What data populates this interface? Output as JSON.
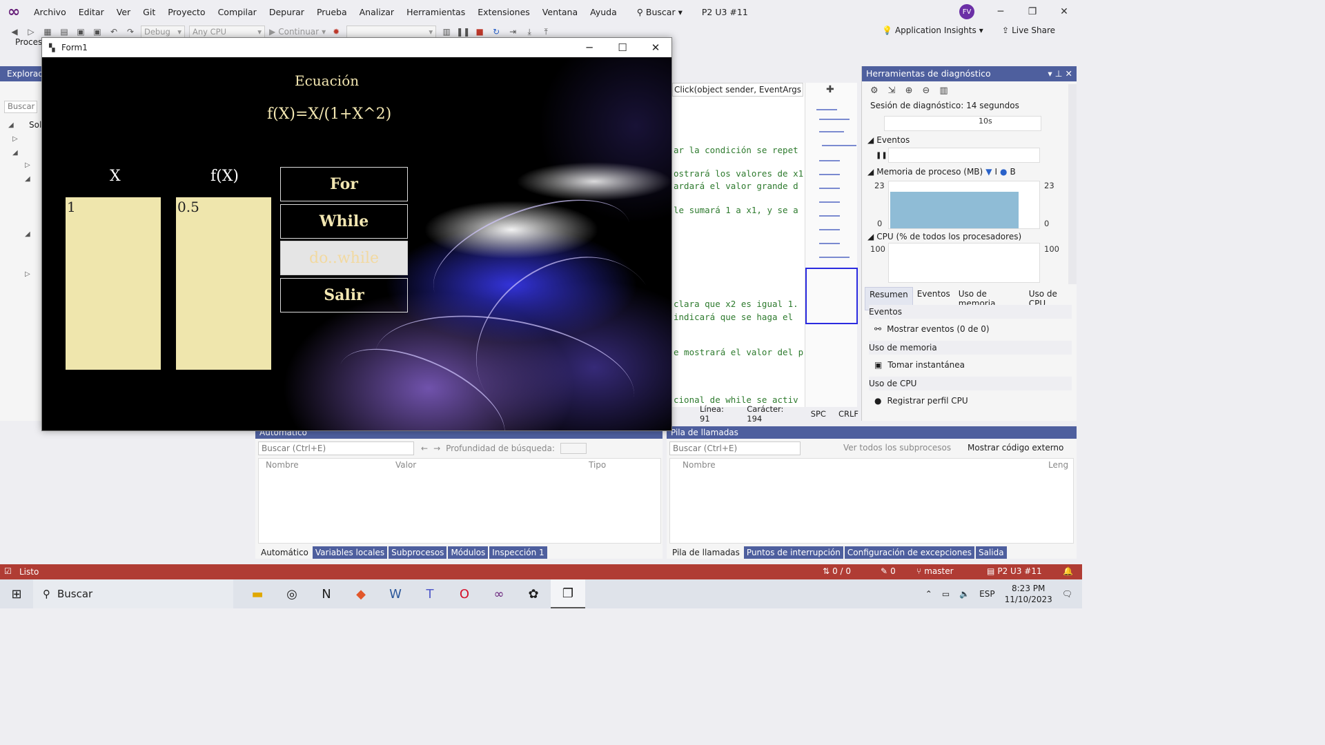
{
  "menu": {
    "items": [
      "Archivo",
      "Editar",
      "Ver",
      "Git",
      "Proyecto",
      "Compilar",
      "Depurar",
      "Prueba",
      "Analizar",
      "Herramientas",
      "Extensiones",
      "Ventana",
      "Ayuda"
    ],
    "search_label": "Buscar",
    "solution_name": "P2 U3 #11",
    "avatar_initials": "FV"
  },
  "toolbar": {
    "config": "Debug",
    "platform": "Any CPU",
    "continue_label": "Continuar",
    "insights_label": "Application Insights",
    "liveshare_label": "Live Share"
  },
  "left_panel": {
    "title": "Explorad",
    "search_placeholder": "Buscar e",
    "tree_label": "Sol",
    "bottom_label": "Proces"
  },
  "form": {
    "title": "Form1",
    "equation_title": "Ecuación",
    "equation_formula": "f(X)=X/(1+X^2)",
    "col_x_label": "X",
    "col_fx_label": "f(X)",
    "list_x": [
      "1"
    ],
    "list_fx": [
      "0.5"
    ],
    "buttons": {
      "for": "For",
      "while": "While",
      "dowhile": "do..while",
      "salir": "Salir"
    }
  },
  "code": {
    "method_combo": "Click(object sender, EventArgs e)",
    "lines": [
      "ar la condición se repet",
      "ostrará los valores de x1",
      "ardará el valor grande d",
      "le sumará 1 a x1, y se a",
      "clara que x2 es igual 1.",
      "indicará que se haga el",
      "e mostrará el valor del p",
      "cional de while se activ"
    ],
    "status_line": "Línea: 91",
    "status_char": "Carácter: 194",
    "status_spc": "SPC",
    "status_crlf": "CRLF"
  },
  "diagnostics": {
    "title": "Herramientas de diagnóstico",
    "session": "Sesión de diagnóstico: 14 segundos",
    "timeline_tick": "10s",
    "events_label": "Eventos",
    "memory_label": "Memoria de proceso (MB)",
    "memory_legend_1": "I",
    "memory_legend_2": "B",
    "memory_max": "23",
    "memory_min": "0",
    "memory_fill_fraction": 0.78,
    "cpu_label": "CPU (% de todos los procesadores)",
    "cpu_max": "100",
    "tabs": [
      "Resumen",
      "Eventos",
      "Uso de memoria",
      "Uso de CPU"
    ],
    "sections": {
      "events_title": "Eventos",
      "events_action": "Mostrar eventos (0 de 0)",
      "memory_title": "Uso de memoria",
      "memory_action": "Tomar instantánea",
      "cpu_title": "Uso de CPU",
      "cpu_action": "Registrar perfil CPU"
    }
  },
  "autos": {
    "title": "Automático",
    "search_placeholder": "Buscar (Ctrl+E)",
    "depth_label": "Profundidad de búsqueda:",
    "columns": [
      "Nombre",
      "Valor",
      "Tipo"
    ],
    "tabs": [
      "Automático",
      "Variables locales",
      "Subprocesos",
      "Módulos",
      "Inspección 1"
    ]
  },
  "callstack": {
    "title": "Pila de llamadas",
    "search_placeholder": "Buscar (Ctrl+E)",
    "threads_label": "Ver todos los subprocesos",
    "external_label": "Mostrar código externo",
    "columns": [
      "Nombre",
      "Leng"
    ],
    "tabs": [
      "Pila de llamadas",
      "Puntos de interrupción",
      "Configuración de excepciones",
      "Salida"
    ]
  },
  "statusbar": {
    "ready": "Listo",
    "sync": "0 / 0",
    "edits": "0",
    "branch": "master",
    "repo": "P2 U3 #11"
  },
  "taskbar": {
    "search_label": "Buscar",
    "language": "ESP",
    "time": "8:23 PM",
    "date": "11/10/2023"
  }
}
